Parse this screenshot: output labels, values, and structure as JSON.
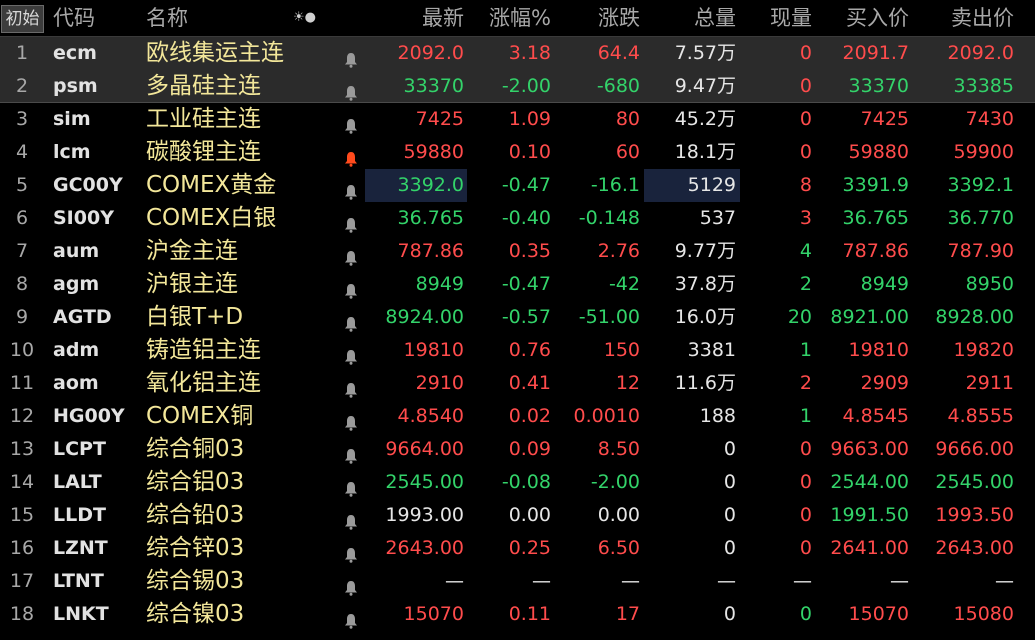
{
  "header": {
    "init_button": "初始",
    "code": "代码",
    "name": "名称",
    "settings_glyph": "☀●",
    "last": "最新",
    "pct": "涨幅%",
    "change": "涨跌",
    "volume": "总量",
    "current": "现量",
    "bid": "买入价",
    "ask": "卖出价"
  },
  "colors": {
    "up": "#ff4c4c",
    "down": "#33d36a",
    "name": "#f3e79a",
    "bell_active": "#ff4a1c",
    "bell_inactive": "#9a9a9a",
    "highlight_box": "#19233c"
  },
  "rows": [
    {
      "idx": "1",
      "code": "ecm",
      "name": "欧线集运主连",
      "bell": "inactive",
      "last": "2092.0",
      "pct": "3.18",
      "chg": "64.4",
      "vol": "7.57万",
      "cur": "0",
      "bid": "2091.7",
      "ask": "2092.0",
      "dir": "up",
      "cur_dir": "up",
      "bid_dir": "up",
      "ask_dir": "up"
    },
    {
      "idx": "2",
      "code": "psm",
      "name": "多晶硅主连",
      "bell": "inactive",
      "last": "33370",
      "pct": "-2.00",
      "chg": "-680",
      "vol": "9.47万",
      "cur": "0",
      "bid": "33370",
      "ask": "33385",
      "dir": "dn",
      "cur_dir": "up",
      "bid_dir": "dn",
      "ask_dir": "dn"
    },
    {
      "idx": "3",
      "code": "sim",
      "name": "工业硅主连",
      "bell": "inactive",
      "last": "7425",
      "pct": "1.09",
      "chg": "80",
      "vol": "45.2万",
      "cur": "0",
      "bid": "7425",
      "ask": "7430",
      "dir": "up",
      "cur_dir": "up",
      "bid_dir": "up",
      "ask_dir": "up"
    },
    {
      "idx": "4",
      "code": "lcm",
      "name": "碳酸锂主连",
      "bell": "active",
      "last": "59880",
      "pct": "0.10",
      "chg": "60",
      "vol": "18.1万",
      "cur": "0",
      "bid": "59880",
      "ask": "59900",
      "dir": "up",
      "cur_dir": "up",
      "bid_dir": "up",
      "ask_dir": "up"
    },
    {
      "idx": "5",
      "code": "GC00Y",
      "name": "COMEX黄金",
      "bell": "inactive",
      "last": "3392.0",
      "pct": "-0.47",
      "chg": "-16.1",
      "vol": "5129",
      "cur": "8",
      "bid": "3391.9",
      "ask": "3392.1",
      "dir": "dn",
      "cur_dir": "up",
      "bid_dir": "dn",
      "ask_dir": "dn"
    },
    {
      "idx": "6",
      "code": "SI00Y",
      "name": "COMEX白银",
      "bell": "inactive",
      "last": "36.765",
      "pct": "-0.40",
      "chg": "-0.148",
      "vol": "537",
      "cur": "3",
      "bid": "36.765",
      "ask": "36.770",
      "dir": "dn",
      "cur_dir": "up",
      "bid_dir": "dn",
      "ask_dir": "dn"
    },
    {
      "idx": "7",
      "code": "aum",
      "name": "沪金主连",
      "bell": "inactive",
      "last": "787.86",
      "pct": "0.35",
      "chg": "2.76",
      "vol": "9.77万",
      "cur": "4",
      "bid": "787.86",
      "ask": "787.90",
      "dir": "up",
      "cur_dir": "dn",
      "bid_dir": "up",
      "ask_dir": "up"
    },
    {
      "idx": "8",
      "code": "agm",
      "name": "沪银主连",
      "bell": "inactive",
      "last": "8949",
      "pct": "-0.47",
      "chg": "-42",
      "vol": "37.8万",
      "cur": "2",
      "bid": "8949",
      "ask": "8950",
      "dir": "dn",
      "cur_dir": "dn",
      "bid_dir": "dn",
      "ask_dir": "dn"
    },
    {
      "idx": "9",
      "code": "AGTD",
      "name": "白银T+D",
      "bell": "inactive",
      "last": "8924.00",
      "pct": "-0.57",
      "chg": "-51.00",
      "vol": "16.0万",
      "cur": "20",
      "bid": "8921.00",
      "ask": "8928.00",
      "dir": "dn",
      "cur_dir": "dn",
      "bid_dir": "dn",
      "ask_dir": "dn"
    },
    {
      "idx": "10",
      "code": "adm",
      "name": "铸造铝主连",
      "bell": "inactive",
      "last": "19810",
      "pct": "0.76",
      "chg": "150",
      "vol": "3381",
      "cur": "1",
      "bid": "19810",
      "ask": "19820",
      "dir": "up",
      "cur_dir": "dn",
      "bid_dir": "up",
      "ask_dir": "up"
    },
    {
      "idx": "11",
      "code": "aom",
      "name": "氧化铝主连",
      "bell": "inactive",
      "last": "2910",
      "pct": "0.41",
      "chg": "12",
      "vol": "11.6万",
      "cur": "2",
      "bid": "2909",
      "ask": "2911",
      "dir": "up",
      "cur_dir": "up",
      "bid_dir": "up",
      "ask_dir": "up"
    },
    {
      "idx": "12",
      "code": "HG00Y",
      "name": "COMEX铜",
      "bell": "inactive",
      "last": "4.8540",
      "pct": "0.02",
      "chg": "0.0010",
      "vol": "188",
      "cur": "1",
      "bid": "4.8545",
      "ask": "4.8555",
      "dir": "up",
      "cur_dir": "dn",
      "bid_dir": "up",
      "ask_dir": "up"
    },
    {
      "idx": "13",
      "code": "LCPT",
      "name": "综合铜03",
      "bell": "inactive",
      "last": "9664.00",
      "pct": "0.09",
      "chg": "8.50",
      "vol": "0",
      "cur": "0",
      "bid": "9663.00",
      "ask": "9666.00",
      "dir": "up",
      "cur_dir": "up",
      "bid_dir": "up",
      "ask_dir": "up"
    },
    {
      "idx": "14",
      "code": "LALT",
      "name": "综合铝03",
      "bell": "inactive",
      "last": "2545.00",
      "pct": "-0.08",
      "chg": "-2.00",
      "vol": "0",
      "cur": "0",
      "bid": "2544.00",
      "ask": "2545.00",
      "dir": "dn",
      "cur_dir": "up",
      "bid_dir": "dn",
      "ask_dir": "dn"
    },
    {
      "idx": "15",
      "code": "LLDT",
      "name": "综合铅03",
      "bell": "inactive",
      "last": "1993.00",
      "pct": "0.00",
      "chg": "0.00",
      "vol": "0",
      "cur": "0",
      "bid": "1991.50",
      "ask": "1993.50",
      "dir": "eq",
      "cur_dir": "up",
      "bid_dir": "dn",
      "ask_dir": "up"
    },
    {
      "idx": "16",
      "code": "LZNT",
      "name": "综合锌03",
      "bell": "inactive",
      "last": "2643.00",
      "pct": "0.25",
      "chg": "6.50",
      "vol": "0",
      "cur": "0",
      "bid": "2641.00",
      "ask": "2643.00",
      "dir": "up",
      "cur_dir": "up",
      "bid_dir": "up",
      "ask_dir": "up"
    },
    {
      "idx": "17",
      "code": "LTNT",
      "name": "综合锡03",
      "bell": "inactive",
      "last": "—",
      "pct": "—",
      "chg": "—",
      "vol": "—",
      "cur": "—",
      "bid": "—",
      "ask": "—",
      "dir": "eq",
      "cur_dir": "eq",
      "bid_dir": "eq",
      "ask_dir": "eq"
    },
    {
      "idx": "18",
      "code": "LNKT",
      "name": "综合镍03",
      "bell": "inactive",
      "last": "15070",
      "pct": "0.11",
      "chg": "17",
      "vol": "0",
      "cur": "0",
      "bid": "15070",
      "ask": "15080",
      "dir": "up",
      "cur_dir": "dn",
      "bid_dir": "up",
      "ask_dir": "up"
    }
  ]
}
